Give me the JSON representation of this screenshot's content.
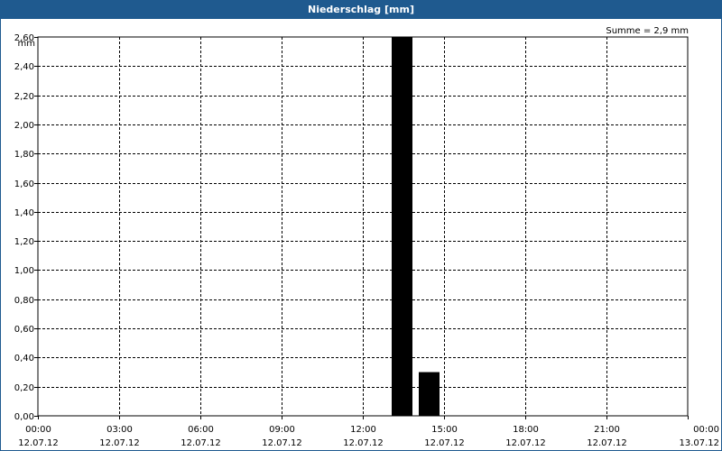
{
  "window": {
    "title": "Niederschlag [mm]"
  },
  "chart_data": {
    "type": "bar",
    "title": "Niederschlag [mm]",
    "ylabel": "mm",
    "summary": "Summe = 2,9 mm",
    "ylim": [
      0,
      2.6
    ],
    "xlim_hours": [
      0,
      24
    ],
    "grid": true,
    "bar_color": "#000000",
    "y_ticks": [
      "0,00",
      "0,20",
      "0,40",
      "0,60",
      "0,80",
      "1,00",
      "1,20",
      "1,40",
      "1,60",
      "1,80",
      "2,00",
      "2,20",
      "2,40",
      "2,60"
    ],
    "x_ticks": [
      {
        "time": "00:00",
        "date": "12.07.12"
      },
      {
        "time": "03:00",
        "date": "12.07.12"
      },
      {
        "time": "06:00",
        "date": "12.07.12"
      },
      {
        "time": "09:00",
        "date": "12.07.12"
      },
      {
        "time": "12:00",
        "date": "12.07.12"
      },
      {
        "time": "15:00",
        "date": "12.07.12"
      },
      {
        "time": "18:00",
        "date": "12.07.12"
      },
      {
        "time": "21:00",
        "date": "12.07.12"
      },
      {
        "time": "00:00",
        "date": "13.07.12"
      }
    ],
    "bars": [
      {
        "start": "13:00",
        "end": "14:00",
        "value": 2.6
      },
      {
        "start": "14:00",
        "end": "15:00",
        "value": 0.3
      }
    ]
  }
}
